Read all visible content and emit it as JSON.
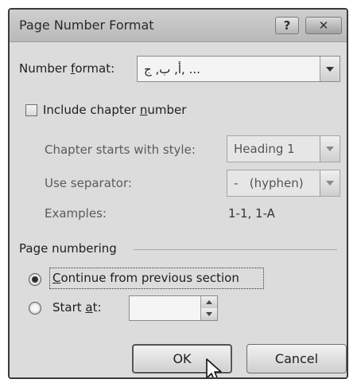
{
  "dialog": {
    "title": "Page Number Format",
    "help_label": "?",
    "close_label": "✕"
  },
  "number_format": {
    "label_pre": "Number ",
    "label_u": "f",
    "label_post": "ormat:",
    "value": "أ, ب, ج, ..."
  },
  "chapter": {
    "include_pre": "Include chapter ",
    "include_u": "n",
    "include_post": "umber",
    "include_checked": false,
    "starts_with_label": "Chapter starts with style:",
    "starts_with_value": "Heading 1",
    "separator_label": "Use separator:",
    "separator_value": "-   (hyphen)",
    "examples_label": "Examples:",
    "examples_value": "1-1, 1-A"
  },
  "page_numbering": {
    "group_label": "Page numbering",
    "continue_u": "C",
    "continue_post": "ontinue from previous section",
    "continue_selected": true,
    "start_pre": "Start ",
    "start_u": "a",
    "start_post": "t:",
    "start_value": ""
  },
  "buttons": {
    "ok": "OK",
    "cancel": "Cancel"
  },
  "icons": {
    "cursor": "mouse-pointer-icon",
    "dropdown": "chevron-down-icon"
  }
}
